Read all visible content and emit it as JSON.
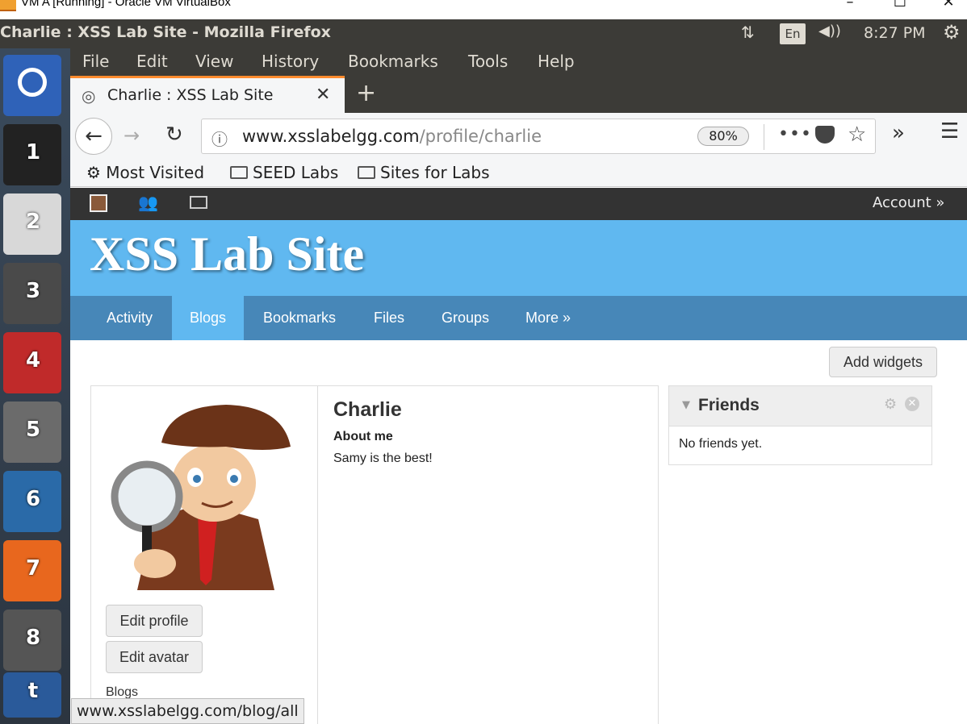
{
  "host_window": {
    "title": "VM A [Running] - Oracle VM VirtualBox",
    "controls": {
      "minimize": "–",
      "maximize": "☐",
      "close": "✕"
    }
  },
  "ubuntu_panel": {
    "window_title": "Charlie : XSS Lab Site - Mozilla Firefox",
    "network_icon": "⇅",
    "lang": "En",
    "volume_icon": "◀))",
    "clock": "8:27 PM",
    "settings_icon": "⚙"
  },
  "launcher": {
    "items": [
      "",
      "1",
      "2",
      "3",
      "4",
      "5",
      "6",
      "7",
      "8",
      "t"
    ]
  },
  "firefox": {
    "menu": [
      "File",
      "Edit",
      "View",
      "History",
      "Bookmarks",
      "Tools",
      "Help"
    ],
    "tab": {
      "label": "Charlie : XSS Lab Site",
      "close": "✕"
    },
    "new_tab": "+",
    "nav": {
      "back": "←",
      "forward": "→",
      "reload": "↻"
    },
    "url": {
      "host": "www.xsslabelgg.com",
      "path": "/profile/charlie",
      "zoom": "80%"
    },
    "page_actions": "•••",
    "overflow": "»",
    "menu_button": "☰",
    "bookmarks": [
      "Most Visited",
      "SEED Labs",
      "Sites for Labs"
    ],
    "bookmark_gear": "⚙",
    "status_url": "www.xsslabelgg.com/blog/all"
  },
  "site": {
    "account": "Account »",
    "title": "XSS Lab Site",
    "nav": [
      "Activity",
      "Blogs",
      "Bookmarks",
      "Files",
      "Groups",
      "More »"
    ],
    "active_nav": "Blogs",
    "add_widgets": "Add widgets",
    "profile": {
      "name": "Charlie",
      "about_heading": "About me",
      "about_text": "Samy is the best!",
      "edit_profile": "Edit profile",
      "edit_avatar": "Edit avatar",
      "blogs_link": "Blogs"
    },
    "friends_widget": {
      "title": "Friends",
      "toggle": "▼",
      "gear": "⚙",
      "close": "✕",
      "empty": "No friends yet."
    }
  },
  "colors": {
    "header_blue": "#60b8f0",
    "nav_blue": "#4787b8",
    "topbar": "#333333",
    "ubuntu_panel": "#3c3b37",
    "tab_accent": "#ff8b2e"
  }
}
